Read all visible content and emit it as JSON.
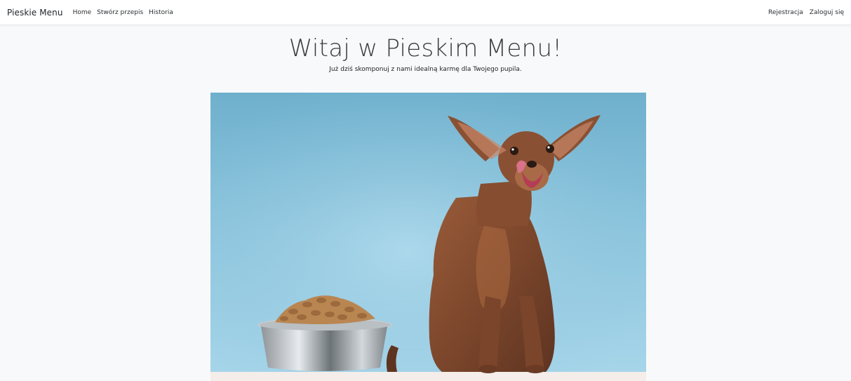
{
  "navbar": {
    "brand": "Pieskie Menu",
    "links": [
      "Home",
      "Stwórz przepis",
      "Historia"
    ],
    "right_links": [
      "Rejestracja",
      "Zaloguj się"
    ]
  },
  "hero": {
    "title": "Witaj w Pieskim Menu!",
    "subtitle": "Już dziś skomponuj z nami idealną karmę dla Twojego pupila."
  },
  "colors": {
    "page_background": "#f8f9fb",
    "photo_background": "#8ac2da",
    "dog_brown": "#8a5033"
  },
  "image": {
    "subject": "dog-with-food-bowl-photo"
  }
}
